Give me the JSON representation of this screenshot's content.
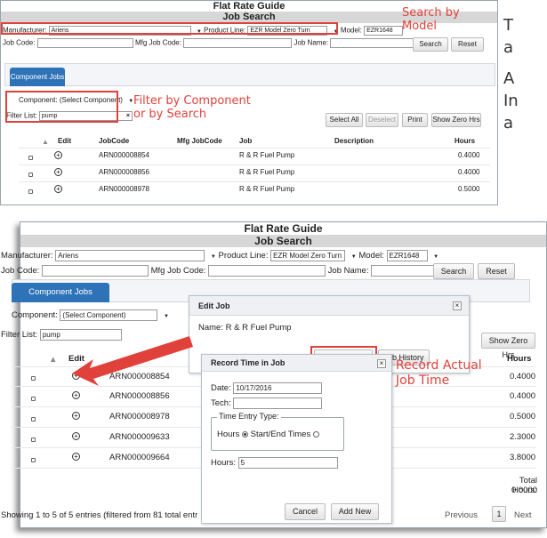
{
  "side_text": {
    "l1": "T",
    "l2": "a",
    "l3": "A",
    "l4": "In",
    "l5": "a"
  },
  "guide": {
    "title": "Flat Rate Guide",
    "subtitle": "Job Search"
  },
  "top": {
    "manufacturer_label": "Manufacturer:",
    "manufacturer_value": "Ariens",
    "product_line_label": "Product Line:",
    "product_line_value": "EZR Model Zero Turn",
    "model_label": "Model:",
    "model_value": "EZR1648",
    "job_code_label": "Job Code:",
    "mfg_job_code_label": "Mfg Job Code:",
    "job_name_label": "Job Name:",
    "search_button": "Search",
    "reset_button": "Reset"
  },
  "component_tab": "Component Jobs",
  "filters": {
    "component_label": "Component:",
    "component_value": "(Select Component)",
    "filter_label": "Filter List:",
    "filter_value": "pump"
  },
  "actions": {
    "select_all": "Select All",
    "deselect": "Deselect",
    "print": "Print",
    "show_zero": "Show Zero Hrs"
  },
  "columns": {
    "edit": "Edit",
    "job_code": "JobCode",
    "mfg_job_code": "Mfg JobCode",
    "job": "Job",
    "description": "Description",
    "hours": "Hours"
  },
  "rows": [
    {
      "code": "ARN000008854",
      "job": "R & R Fuel Pump",
      "hours": "0.4000"
    },
    {
      "code": "ARN000008856",
      "job": "R & R Fuel Pump",
      "hours": "0.4000"
    },
    {
      "code": "ARN000008978",
      "job": "R & R Fuel Pump",
      "hours": "0.5000"
    },
    {
      "code": "ARN000009633",
      "hours": "2.3000"
    },
    {
      "code": "ARN000009664",
      "hours": "3.8000"
    }
  ],
  "total_hours_label": "Total Hours:",
  "total_hours_value": "0.0000",
  "showing_text": "Showing 1 to 5 of 5 entries (filtered from 81 total entr",
  "pagination": {
    "previous": "Previous",
    "page": "1",
    "next": "Next"
  },
  "edit_job": {
    "title": "Edit Job",
    "name_text": "Name: R & R Fuel Pump",
    "record_time": "Record Time",
    "job_history": "Job History"
  },
  "record_dialog": {
    "title": "Record Time in Job",
    "date_label": "Date:",
    "date_value": "10/17/2016",
    "tech_label": "Tech:",
    "time_entry_type": "Time Entry Type:",
    "hours_option": "Hours",
    "start_end_option": "Start/End Times",
    "hours_label": "Hours:",
    "hours_value": "5",
    "cancel": "Cancel",
    "add_new": "Add New"
  },
  "annotations": {
    "search_by_model": "Search by Model",
    "filter_line1": "Filter by Component",
    "filter_line2": "or by Search",
    "record_line1": "Record Actual",
    "record_line2": "Job Time"
  },
  "colors": {
    "accent": "#2e73b8",
    "annotation": "#e0413b"
  },
  "icons": {
    "close": "close-icon",
    "add": "plus-circle-icon",
    "arrow": "red-arrow-icon"
  }
}
